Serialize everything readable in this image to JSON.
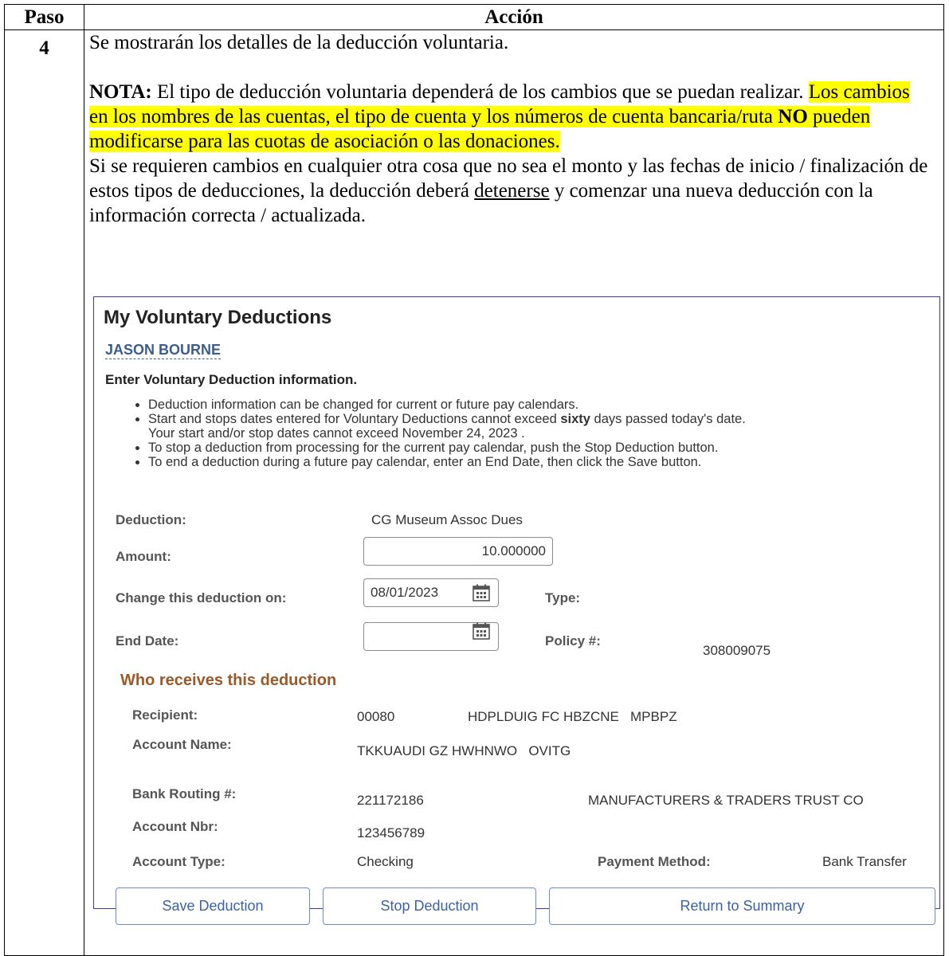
{
  "table": {
    "header_paso": "Paso",
    "header_accion": "Acción",
    "step_number": "4"
  },
  "instructions": {
    "line1": "Se mostrarán los detalles de la deducción voluntaria.",
    "nota_label": "NOTA:",
    "nota_text": " El tipo de deducción voluntaria dependerá de los cambios que se puedan realizar. ",
    "highlight_part1": "Los cambios en los nombres de las cuentas, el tipo de cuenta y los números de cuenta bancaria/ruta ",
    "highlight_no": "NO",
    "highlight_part2": " pueden modificarse para las cuotas de asociación o las donaciones.",
    "para2_part1": "Si se requieren cambios en cualquier otra cosa que no sea el monto y las fechas de inicio / finalización de estos tipos de deducciones,  la deducción deberá ",
    "para2_underlined": "detenerse",
    "para2_part2": " y comenzar una nueva deducción con la información correcta / actualizada."
  },
  "panel": {
    "title": "My Voluntary Deductions",
    "employee_name": "JASON BOURNE",
    "enter_info": "Enter Voluntary Deduction information.",
    "bullets": [
      "Deduction information can be changed for current or future pay calendars.",
      "Start and stops dates entered for Voluntary Deductions cannot exceed ",
      "sixty",
      " days passed today's date.",
      "Your start and/or stop dates cannot exceed November 24, 2023 .",
      "To stop a deduction from processing for the current pay calendar, push the Stop Deduction button.",
      "To end a deduction during a future pay calendar, enter an End Date, then click the Save button."
    ],
    "fields": {
      "deduction_label": "Deduction:",
      "deduction_value": "CG Museum Assoc Dues",
      "amount_label": "Amount:",
      "amount_value": "10.000000",
      "change_on_label": "Change this deduction on:",
      "change_on_value": "08/01/2023",
      "type_label": "Type:",
      "end_date_label": "End Date:",
      "end_date_value": "",
      "policy_label": "Policy #:",
      "policy_value": "308009075"
    },
    "section_title": "Who receives this deduction",
    "recipient": {
      "recipient_label": "Recipient:",
      "recipient_code": "00080",
      "recipient_name": "HDPLDUIG FC HBZCNE   MPBPZ",
      "account_name_label": "Account Name:",
      "account_name_value": "TKKUAUDI GZ HWHNWO   OVITG",
      "routing_label": "Bank Routing #:",
      "routing_value": "221172186",
      "bank_name": "MANUFACTURERS & TRADERS TRUST CO",
      "account_nbr_label": "Account Nbr:",
      "account_nbr_value": "123456789",
      "account_type_label": "Account Type:",
      "account_type_value": "Checking",
      "payment_method_label": "Payment Method:",
      "payment_method_value": "Bank Transfer"
    },
    "buttons": {
      "save": "Save Deduction",
      "stop": "Stop Deduction",
      "return": "Return to Summary"
    },
    "icons": {
      "calendar": "calendar-icon"
    }
  }
}
